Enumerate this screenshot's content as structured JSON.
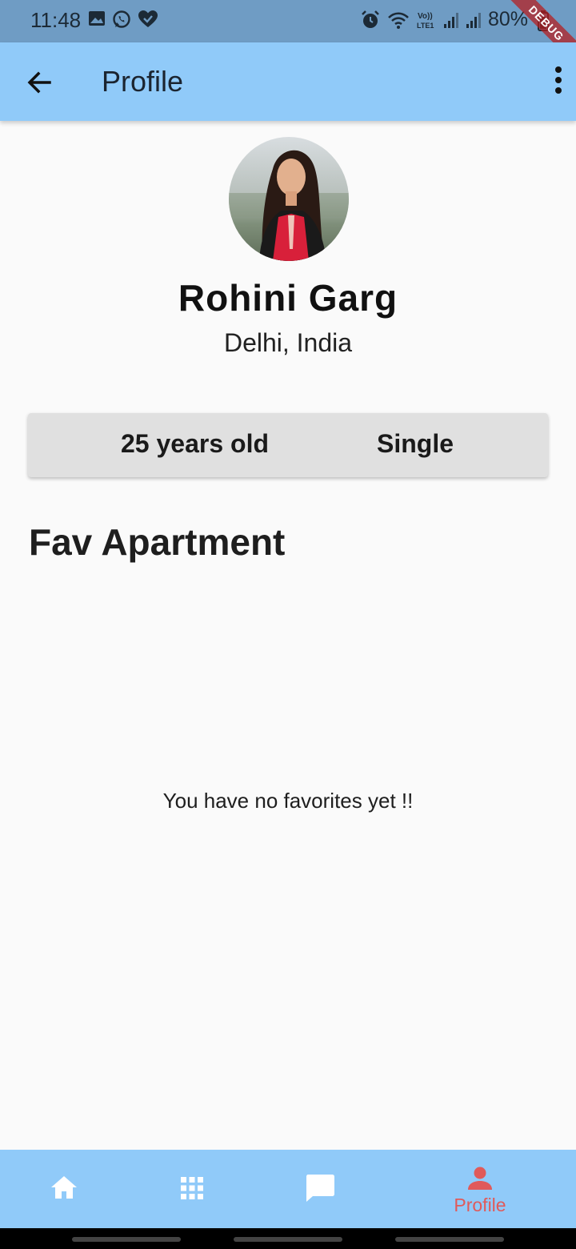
{
  "status_bar": {
    "time": "11:48",
    "battery": "80%",
    "left_icons": [
      "image-icon",
      "whatsapp-icon",
      "heart-check-icon"
    ],
    "right_icons": [
      "alarm-icon",
      "wifi-icon",
      "volte-icon",
      "signal-icon",
      "signal-icon",
      "battery-icon"
    ],
    "ribbon": "DEBUG"
  },
  "app_bar": {
    "title": "Profile",
    "back_icon": "arrow-back-icon",
    "menu_icon": "more-vert-icon",
    "background": "#90caf9"
  },
  "profile": {
    "name": "Rohini Garg",
    "location": "Delhi, India",
    "age": "25 years old",
    "relationship": "Single"
  },
  "favorites": {
    "title": "Fav Apartment",
    "empty_message": "You have no favorites yet !!"
  },
  "bottom_nav": {
    "items": [
      {
        "icon": "home-icon",
        "label": ""
      },
      {
        "icon": "apps-grid-icon",
        "label": ""
      },
      {
        "icon": "chat-icon",
        "label": ""
      },
      {
        "icon": "person-icon",
        "label": "Profile",
        "active": true
      }
    ],
    "active_color": "#e05a5a"
  }
}
